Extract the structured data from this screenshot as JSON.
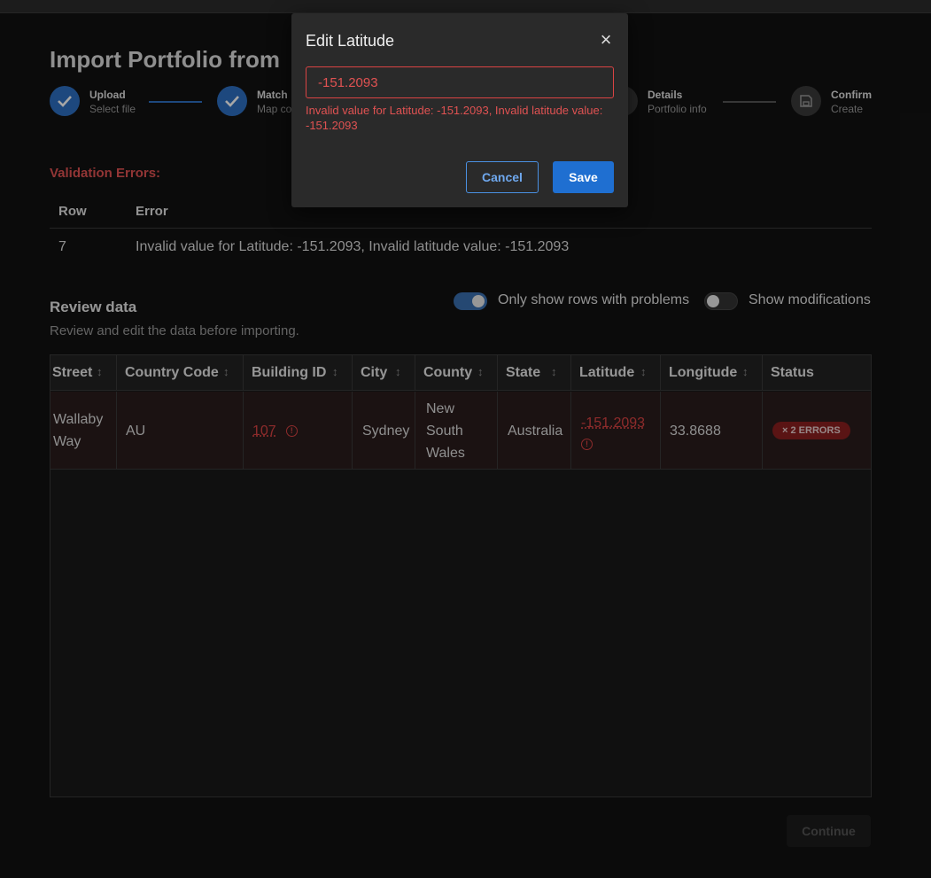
{
  "page": {
    "title": "Import Portfolio from"
  },
  "stepper": {
    "steps": [
      {
        "label": "Upload",
        "sub": "Select file",
        "state": "done"
      },
      {
        "label": "Match",
        "sub": "Map co",
        "state": "done"
      },
      {
        "label": "Details",
        "sub": "Portfolio info",
        "state": "todo"
      },
      {
        "label": "Confirm",
        "sub": "Create",
        "state": "todo"
      }
    ]
  },
  "validation": {
    "title": "Validation Errors:",
    "headers": {
      "row": "Row",
      "error": "Error"
    },
    "rows": [
      {
        "row": "7",
        "error": "Invalid value for Latitude: -151.2093, Invalid latitude value: -151.2093"
      }
    ]
  },
  "review": {
    "title": "Review data",
    "subtitle": "Review and edit the data before importing.",
    "toggle_problems": {
      "label": "Only show rows with problems",
      "on": true
    },
    "toggle_modifications": {
      "label": "Show modifications",
      "on": false
    }
  },
  "table": {
    "columns": [
      "Street",
      "Country Code",
      "Building ID",
      "City",
      "County",
      "State",
      "Latitude",
      "Longitude",
      "Status"
    ],
    "row": {
      "street": "Wallaby Way",
      "country_code": "AU",
      "building_id": "107",
      "city": "Sydney",
      "county": "New South Wales",
      "state": "Australia",
      "latitude": "-151.2093",
      "longitude": "33.8688",
      "status": "2 ERRORS"
    }
  },
  "continue_label": "Continue",
  "dialog": {
    "title": "Edit Latitude",
    "input_value": "-151.2093",
    "error": "Invalid value for Latitude: -151.2093, Invalid latitude value: -151.2093",
    "cancel_label": "Cancel",
    "save_label": "Save"
  },
  "colors": {
    "accent": "#1f6fd1",
    "error": "#d94343",
    "background": "#121212"
  }
}
